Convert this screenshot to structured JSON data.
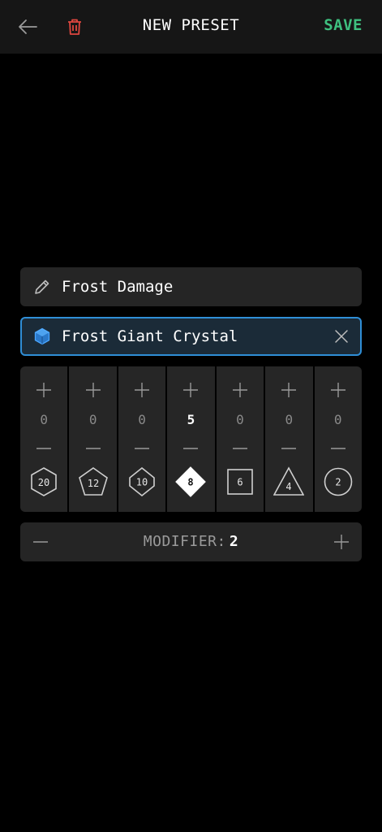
{
  "header": {
    "title": "NEW PRESET",
    "save_label": "SAVE",
    "colors": {
      "save": "#3ec07f",
      "delete": "#e0473f"
    },
    "icons": {
      "back": "arrow-left-icon",
      "delete": "trash-icon"
    }
  },
  "preset": {
    "name": "Frost Damage",
    "name_icon": "pencil-icon",
    "item": "Frost Giant Crystal",
    "item_icon": "hexagon-gem-icon",
    "item_accent": "#2f8ed6"
  },
  "dice": [
    {
      "sides": "20",
      "count": "0",
      "shape": "hexagon"
    },
    {
      "sides": "12",
      "count": "0",
      "shape": "pentagon"
    },
    {
      "sides": "10",
      "count": "0",
      "shape": "diamond"
    },
    {
      "sides": "8",
      "count": "5",
      "shape": "diamond",
      "active": true
    },
    {
      "sides": "6",
      "count": "0",
      "shape": "square"
    },
    {
      "sides": "4",
      "count": "0",
      "shape": "triangle"
    },
    {
      "sides": "2",
      "count": "0",
      "shape": "circle"
    }
  ],
  "modifier": {
    "label": "MODIFIER:",
    "value": "2"
  }
}
